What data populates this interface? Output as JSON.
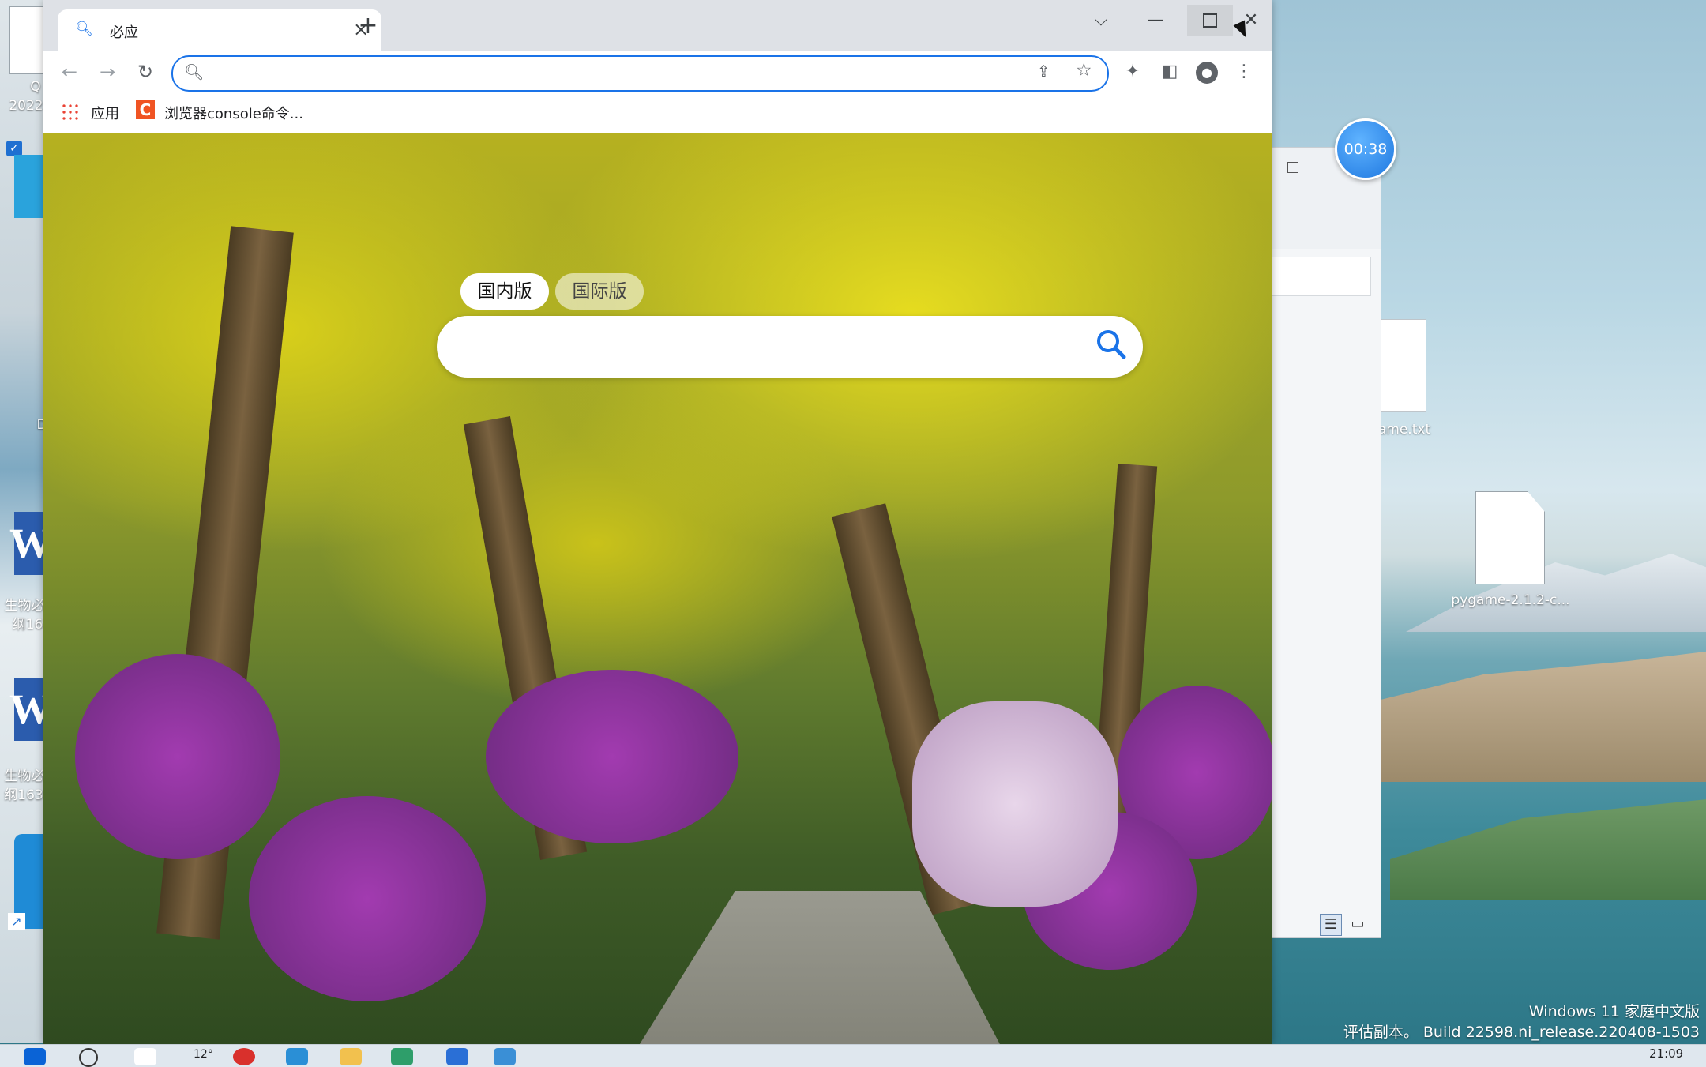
{
  "browser": {
    "tab_title": "必应",
    "tab_icon": "search-icon",
    "new_tab_label": "+",
    "address_value": "",
    "bookmarks": [
      {
        "label": "应用",
        "icon": "apps-grid-icon"
      },
      {
        "label": "浏览器console命令...",
        "icon": "c-logo-icon"
      }
    ]
  },
  "page": {
    "scope_tabs": [
      "国内版",
      "国际版"
    ],
    "search_value": "",
    "search_icon": "magnifier-icon"
  },
  "desktop": {
    "icons": [
      {
        "label": "Q"
      },
      {
        "label": "2022"
      },
      {
        "label": "D"
      },
      {
        "label": "生物必"
      },
      {
        "label": "纲16"
      },
      {
        "label": "生物必"
      },
      {
        "label": "纲163"
      },
      {
        "label": "ame.txt"
      },
      {
        "label": "pygame-2.1.2-c..."
      }
    ],
    "watermark_line1": "Windows 11 家庭中文版",
    "watermark_line2": "评估副本。 Build 22598.ni_release.220408-1503"
  },
  "timer": {
    "value": "00:38"
  },
  "taskbar": {
    "temperature": "12°",
    "clock": "21:09"
  },
  "colors": {
    "accent": "#1a73e8",
    "tabstrip": "#dee1e6",
    "bing_blue": "#1a73e8"
  }
}
